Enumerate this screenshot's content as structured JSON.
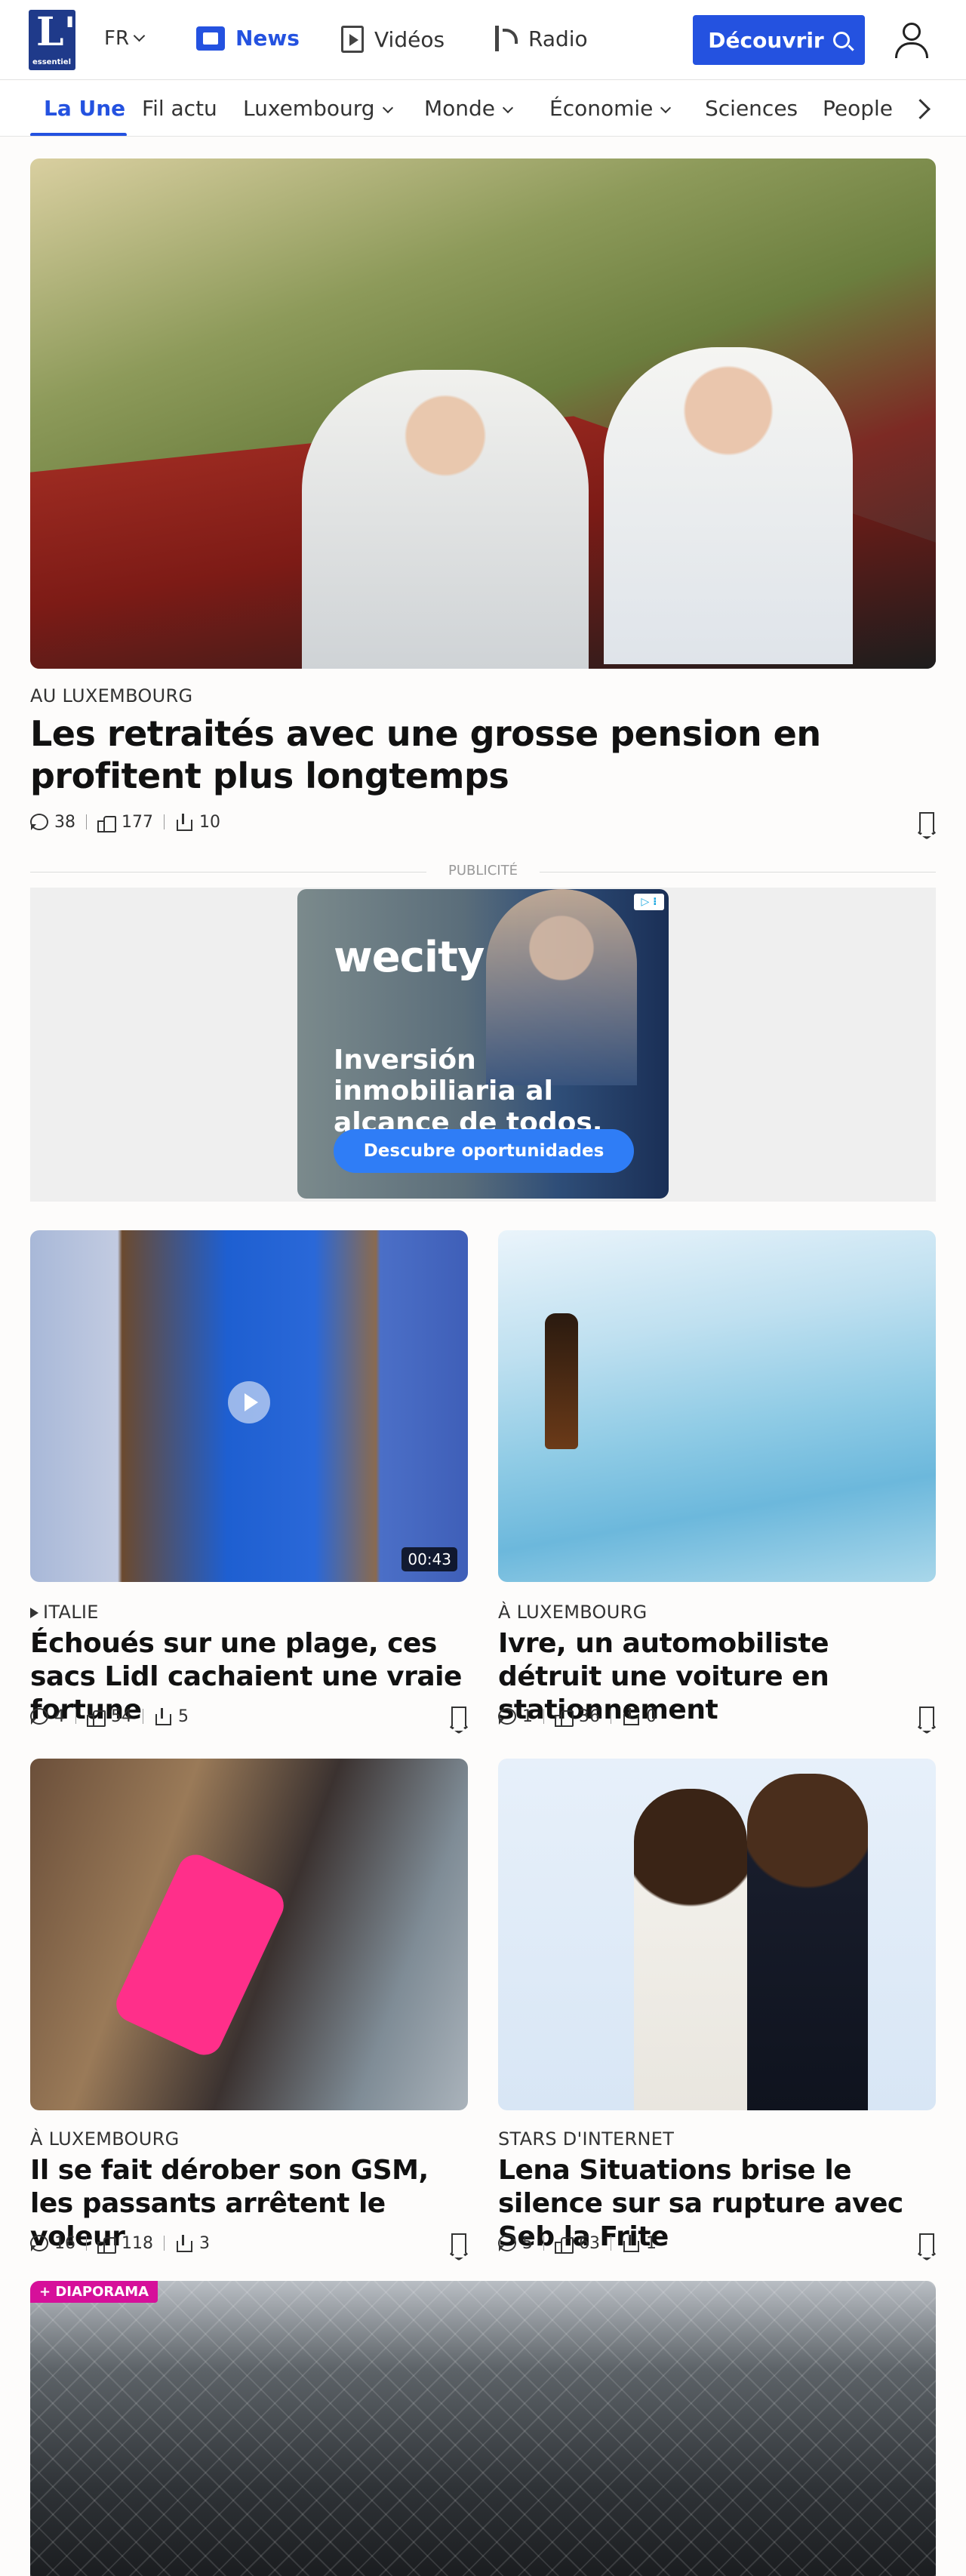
{
  "header": {
    "logo_text": "L'",
    "logo_sub": "essentiel",
    "lang": "FR",
    "nav": [
      {
        "label": "News"
      },
      {
        "label": "Vidéos"
      },
      {
        "label": "Radio"
      }
    ],
    "cta_label": "Découvrir",
    "accent_color": "#2452e0"
  },
  "categories": [
    "La Une",
    "Fil actu",
    "Luxembourg",
    "Monde",
    "Économie",
    "Sciences",
    "People"
  ],
  "hero": {
    "kicker": "AU LUXEMBOURG",
    "title": "Les retraités avec une grosse pension en profitent plus longtemps",
    "comments": "38",
    "likes": "177",
    "shares": "10"
  },
  "ad": {
    "label": "PUBLICITÉ",
    "brand": "wecity",
    "text": "Inversión inmobiliaria al alcance de todos.",
    "cta": "Descubre oportunidades"
  },
  "articles": [
    {
      "kicker": "ITALIE",
      "title": "Échoués sur une plage, ces sacs Lidl cachaient une vraie fortune",
      "comments": "4",
      "likes": "54",
      "shares": "5",
      "duration": "00:43"
    },
    {
      "kicker": "À LUXEMBOURG",
      "title": "Ivre, un automobiliste détruit une voiture en stationnement",
      "comments": "1",
      "likes": "36",
      "shares": "0"
    },
    {
      "kicker": "À LUXEMBOURG",
      "title": "Il se fait dérober son GSM, les passants arrêtent le voleur",
      "comments": "16",
      "likes": "118",
      "shares": "3"
    },
    {
      "kicker": "STARS D'INTERNET",
      "title": "Lena Situations brise le silence sur sa rupture avec Seb la Frite",
      "comments": "5",
      "likes": "63",
      "shares": "1"
    }
  ],
  "diaporama": {
    "badge": "+ DIAPORAMA"
  }
}
